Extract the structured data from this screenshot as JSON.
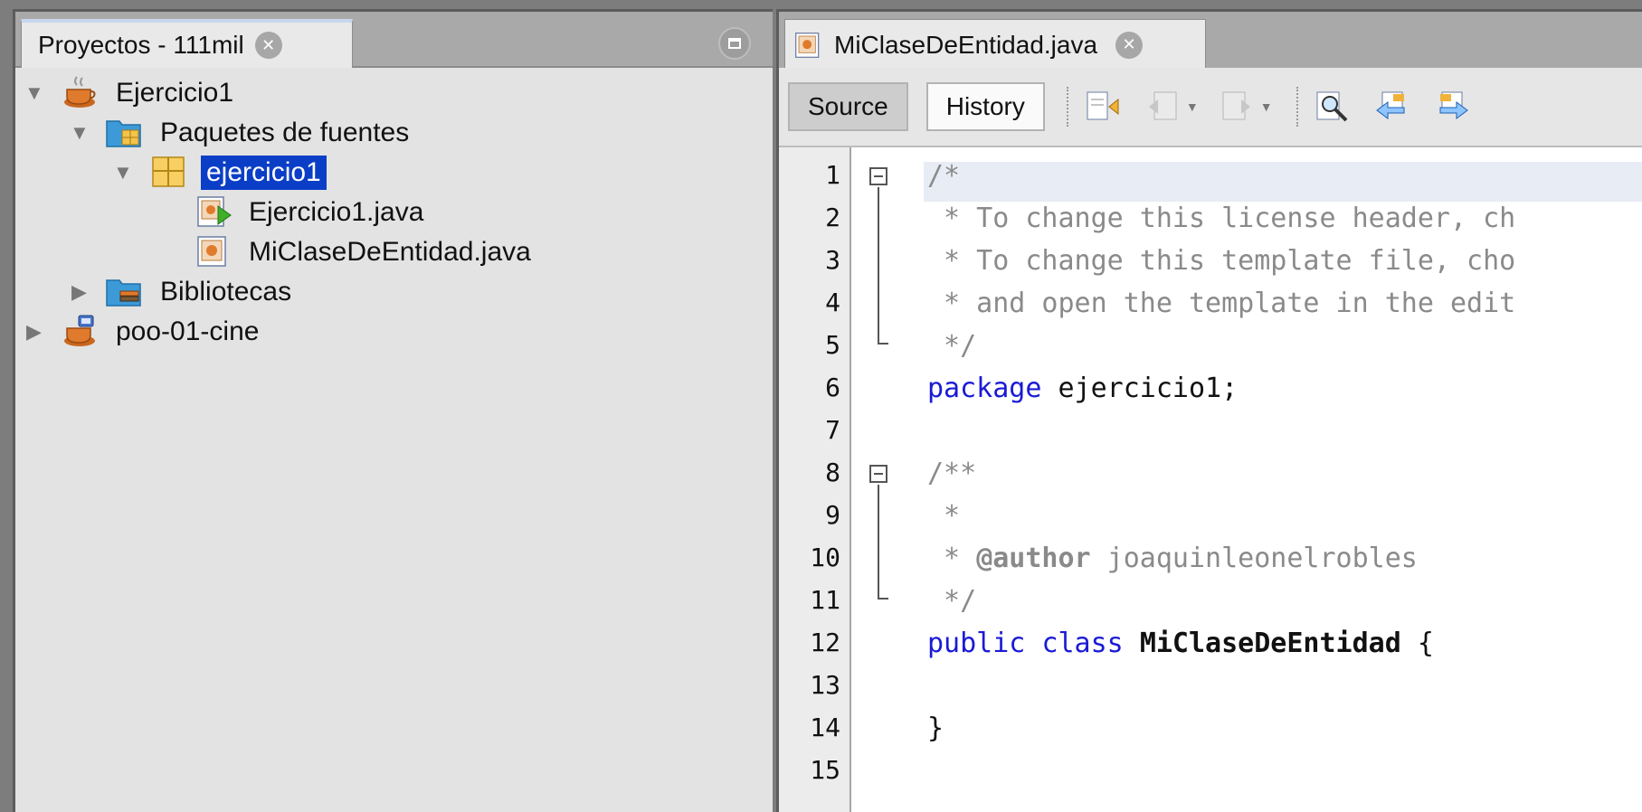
{
  "projects_panel": {
    "tab_title": "Proyectos - 111mil",
    "tree": [
      {
        "label": "Ejercicio1",
        "expanded": true,
        "icon": "coffee-project-icon"
      },
      {
        "label": "Paquetes de fuentes",
        "expanded": true,
        "icon": "source-folder-icon"
      },
      {
        "label": "ejercicio1",
        "expanded": true,
        "icon": "package-icon",
        "selected": true
      },
      {
        "label": "Ejercicio1.java",
        "icon": "java-main-file-icon"
      },
      {
        "label": "MiClaseDeEntidad.java",
        "icon": "java-file-icon"
      },
      {
        "label": "Bibliotecas",
        "expanded": false,
        "icon": "libraries-folder-icon"
      },
      {
        "label": "poo-01-cine",
        "expanded": false,
        "icon": "coffee-project-icon"
      }
    ]
  },
  "editor": {
    "tab_title": "MiClaseDeEntidad.java",
    "toolbar": {
      "source_label": "Source",
      "history_label": "History"
    },
    "line_numbers": [
      "1",
      "2",
      "3",
      "4",
      "5",
      "6",
      "7",
      "8",
      "9",
      "10",
      "11",
      "12",
      "13",
      "14",
      "15"
    ],
    "code": {
      "l1": "/*",
      "l2": " * To change this license header, ch",
      "l3": " * To change this template file, cho",
      "l4": " * and open the template in the edit",
      "l5": " */",
      "l6_kw": "package",
      "l6_rest": " ejercicio1;",
      "l8": "/**",
      "l9": " *",
      "l10_pre": " * ",
      "l10_tag": "@author",
      "l10_rest": " joaquinleonelrobles",
      "l11": " */",
      "l12_kw1": "public",
      "l12_kw2": "class",
      "l12_name": "MiClaseDeEntidad",
      "l12_brace": " {",
      "l14": "}"
    }
  },
  "colors": {
    "selection": "#0b3ec7",
    "keyword": "#1a1ad6",
    "comment": "#8a8a8a"
  }
}
